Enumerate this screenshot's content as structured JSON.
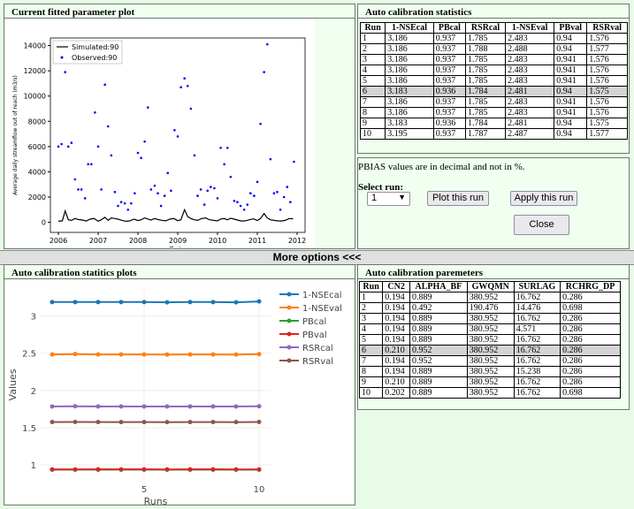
{
  "panels": {
    "fitted_title": "Current fitted parameter plot",
    "stats_title": "Auto calibration statistics",
    "stats_plot_title": "Auto calibration statitics plots",
    "params_title": "Auto calibration paremeters"
  },
  "more_options": "More options <<<",
  "note": "PBIAS values are in decimal and not in %.",
  "select_run_label": "Select run:",
  "select_run_value": "1",
  "buttons": {
    "plot": "Plot this run",
    "apply": "Apply this run",
    "close": "Close"
  },
  "stats_table": {
    "headers": [
      "Run",
      "1-NSEcal",
      "PBcal",
      "RSRcal",
      "1-NSEval",
      "PBval",
      "RSRval"
    ],
    "rows": [
      [
        "1",
        "3.186",
        "0.937",
        "1.785",
        "2.483",
        "0.94",
        "1.576"
      ],
      [
        "2",
        "3.186",
        "0.937",
        "1.788",
        "2.488",
        "0.94",
        "1.577"
      ],
      [
        "3",
        "3.186",
        "0.937",
        "1.785",
        "2.483",
        "0.941",
        "1.576"
      ],
      [
        "4",
        "3.186",
        "0.937",
        "1.785",
        "2.483",
        "0.941",
        "1.576"
      ],
      [
        "5",
        "3.186",
        "0.937",
        "1.785",
        "2.483",
        "0.941",
        "1.576"
      ],
      [
        "6",
        "3.183",
        "0.936",
        "1.784",
        "2.481",
        "0.94",
        "1.575"
      ],
      [
        "7",
        "3.186",
        "0.937",
        "1.785",
        "2.483",
        "0.941",
        "1.576"
      ],
      [
        "8",
        "3.186",
        "0.937",
        "1.785",
        "2.483",
        "0.941",
        "1.576"
      ],
      [
        "9",
        "3.183",
        "0.936",
        "1.784",
        "2.481",
        "0.94",
        "1.575"
      ],
      [
        "10",
        "3.195",
        "0.937",
        "1.787",
        "2.487",
        "0.94",
        "1.577"
      ]
    ],
    "selected_row": 6
  },
  "params_table": {
    "headers": [
      "Run",
      "CN2",
      "ALPHA_BF",
      "GWQMN",
      "SURLAG",
      "RCHRG_DP"
    ],
    "rows": [
      [
        "1",
        "0.194",
        "0.889",
        "380.952",
        "16.762",
        "0.286"
      ],
      [
        "2",
        "0.194",
        "0.492",
        "190.476",
        "14.476",
        "0.698"
      ],
      [
        "3",
        "0.194",
        "0.889",
        "380.952",
        "16.762",
        "0.286"
      ],
      [
        "4",
        "0.194",
        "0.889",
        "380.952",
        "4.571",
        "0.286"
      ],
      [
        "5",
        "0.194",
        "0.889",
        "380.952",
        "16.762",
        "0.286"
      ],
      [
        "6",
        "0.210",
        "0.952",
        "380.952",
        "16.762",
        "0.286"
      ],
      [
        "7",
        "0.194",
        "0.952",
        "380.952",
        "16.762",
        "0.286"
      ],
      [
        "8",
        "0.194",
        "0.889",
        "380.952",
        "15.238",
        "0.286"
      ],
      [
        "9",
        "0.210",
        "0.889",
        "380.952",
        "16.762",
        "0.286"
      ],
      [
        "10",
        "0.202",
        "0.889",
        "380.952",
        "16.762",
        "0.698"
      ]
    ],
    "selected_row": 6
  },
  "chart_data": [
    {
      "type": "scatter",
      "title": "",
      "xlabel": "Date",
      "ylabel": "Average daily streamflow out of reach (m3/s)",
      "xlim": [
        2005.8,
        2012.2
      ],
      "ylim": [
        -800,
        14600
      ],
      "xticks": [
        "2006",
        "2007",
        "2008",
        "2009",
        "2010",
        "2011",
        "2012"
      ],
      "yticks": [
        "0",
        "2000",
        "4000",
        "6000",
        "8000",
        "10000",
        "12000",
        "14000"
      ],
      "legend_position": "top-left",
      "series": [
        {
          "name": "Simulated:90",
          "style": "line",
          "color": "#000000",
          "x": [
            2006.0,
            2006.1,
            2006.17,
            2006.25,
            2006.33,
            2006.42,
            2006.5,
            2006.6,
            2006.7,
            2006.8,
            2006.9,
            2007.0,
            2007.08,
            2007.17,
            2007.25,
            2007.33,
            2007.42,
            2007.5,
            2007.6,
            2007.7,
            2007.8,
            2007.9,
            2008.0,
            2008.08,
            2008.17,
            2008.25,
            2008.33,
            2008.42,
            2008.5,
            2008.6,
            2008.7,
            2008.8,
            2008.9,
            2009.0,
            2009.08,
            2009.17,
            2009.25,
            2009.33,
            2009.42,
            2009.5,
            2009.6,
            2009.7,
            2009.8,
            2009.9,
            2010.0,
            2010.08,
            2010.17,
            2010.25,
            2010.33,
            2010.42,
            2010.5,
            2010.6,
            2010.7,
            2010.8,
            2010.9,
            2011.0,
            2011.08,
            2011.17,
            2011.25,
            2011.33,
            2011.42,
            2011.5,
            2011.6,
            2011.7,
            2011.8,
            2011.9
          ],
          "y": [
            80,
            120,
            900,
            200,
            150,
            300,
            220,
            180,
            100,
            250,
            300,
            90,
            200,
            400,
            160,
            350,
            300,
            250,
            150,
            80,
            120,
            250,
            140,
            200,
            350,
            260,
            180,
            300,
            220,
            160,
            120,
            250,
            300,
            130,
            200,
            1000,
            450,
            300,
            200,
            150,
            300,
            350,
            200,
            150,
            120,
            260,
            300,
            200,
            320,
            250,
            180,
            100,
            120,
            200,
            280,
            140,
            300,
            700,
            350,
            200,
            150,
            120,
            100,
            150,
            300,
            280
          ]
        },
        {
          "name": "Observed:90",
          "style": "point",
          "color": "#0000ff",
          "x": [
            2006.0,
            2006.08,
            2006.17,
            2006.25,
            2006.33,
            2006.42,
            2006.5,
            2006.58,
            2006.67,
            2006.75,
            2006.83,
            2006.92,
            2007.0,
            2007.08,
            2007.17,
            2007.25,
            2007.33,
            2007.42,
            2007.5,
            2007.58,
            2007.67,
            2007.75,
            2007.83,
            2007.92,
            2008.0,
            2008.08,
            2008.17,
            2008.25,
            2008.33,
            2008.42,
            2008.5,
            2008.58,
            2008.67,
            2008.75,
            2008.83,
            2008.92,
            2009.0,
            2009.08,
            2009.17,
            2009.25,
            2009.33,
            2009.42,
            2009.5,
            2009.58,
            2009.67,
            2009.75,
            2009.83,
            2009.92,
            2010.0,
            2010.08,
            2010.17,
            2010.25,
            2010.33,
            2010.42,
            2010.5,
            2010.58,
            2010.67,
            2010.75,
            2010.83,
            2010.92,
            2011.0,
            2011.08,
            2011.17,
            2011.25,
            2011.33,
            2011.42,
            2011.5,
            2011.58,
            2011.67,
            2011.75,
            2011.83,
            2011.92
          ],
          "y": [
            6000,
            6200,
            11900,
            6000,
            6300,
            3400,
            2600,
            2600,
            1900,
            4600,
            4600,
            8700,
            6000,
            2600,
            10900,
            7600,
            5300,
            2400,
            1300,
            1600,
            1500,
            1000,
            1500,
            2300,
            5500,
            5100,
            6400,
            9100,
            2600,
            2900,
            2300,
            1300,
            2100,
            3900,
            2500,
            7300,
            6800,
            10700,
            11400,
            10800,
            9000,
            5300,
            2100,
            2600,
            1400,
            2500,
            2800,
            2700,
            1900,
            5900,
            4600,
            5900,
            3600,
            1700,
            1600,
            1300,
            1000,
            1400,
            2300,
            2100,
            3200,
            7800,
            11900,
            14100,
            5000,
            2300,
            2400,
            1000,
            2000,
            2800,
            1600,
            4800
          ]
        }
      ]
    },
    {
      "type": "line",
      "title": "",
      "xlabel": "Runs",
      "ylabel": "Values",
      "xlim": [
        0.5,
        10.5
      ],
      "ylim": [
        0.8,
        3.35
      ],
      "xticks": [
        "5",
        "10"
      ],
      "yticks": [
        "1",
        "1.5",
        "2",
        "2.5",
        "3"
      ],
      "legend_position": "right",
      "x": [
        1,
        2,
        3,
        4,
        5,
        6,
        7,
        8,
        9,
        10
      ],
      "series": [
        {
          "name": "1-NSEcal",
          "color": "#1f77b4",
          "values": [
            3.186,
            3.186,
            3.186,
            3.186,
            3.186,
            3.183,
            3.186,
            3.186,
            3.183,
            3.195
          ]
        },
        {
          "name": "1-NSEval",
          "color": "#ff7f0e",
          "values": [
            2.483,
            2.488,
            2.483,
            2.483,
            2.483,
            2.481,
            2.483,
            2.483,
            2.481,
            2.487
          ]
        },
        {
          "name": "PBcal",
          "color": "#2ca02c",
          "values": [
            0.937,
            0.937,
            0.937,
            0.937,
            0.937,
            0.936,
            0.937,
            0.937,
            0.936,
            0.937
          ]
        },
        {
          "name": "PBval",
          "color": "#d62728",
          "values": [
            0.94,
            0.94,
            0.941,
            0.941,
            0.941,
            0.94,
            0.941,
            0.941,
            0.94,
            0.94
          ]
        },
        {
          "name": "RSRcal",
          "color": "#9467bd",
          "values": [
            1.785,
            1.788,
            1.785,
            1.785,
            1.785,
            1.784,
            1.785,
            1.785,
            1.784,
            1.787
          ]
        },
        {
          "name": "RSRval",
          "color": "#8c564b",
          "values": [
            1.576,
            1.577,
            1.576,
            1.576,
            1.576,
            1.575,
            1.576,
            1.576,
            1.575,
            1.577
          ]
        }
      ]
    }
  ]
}
